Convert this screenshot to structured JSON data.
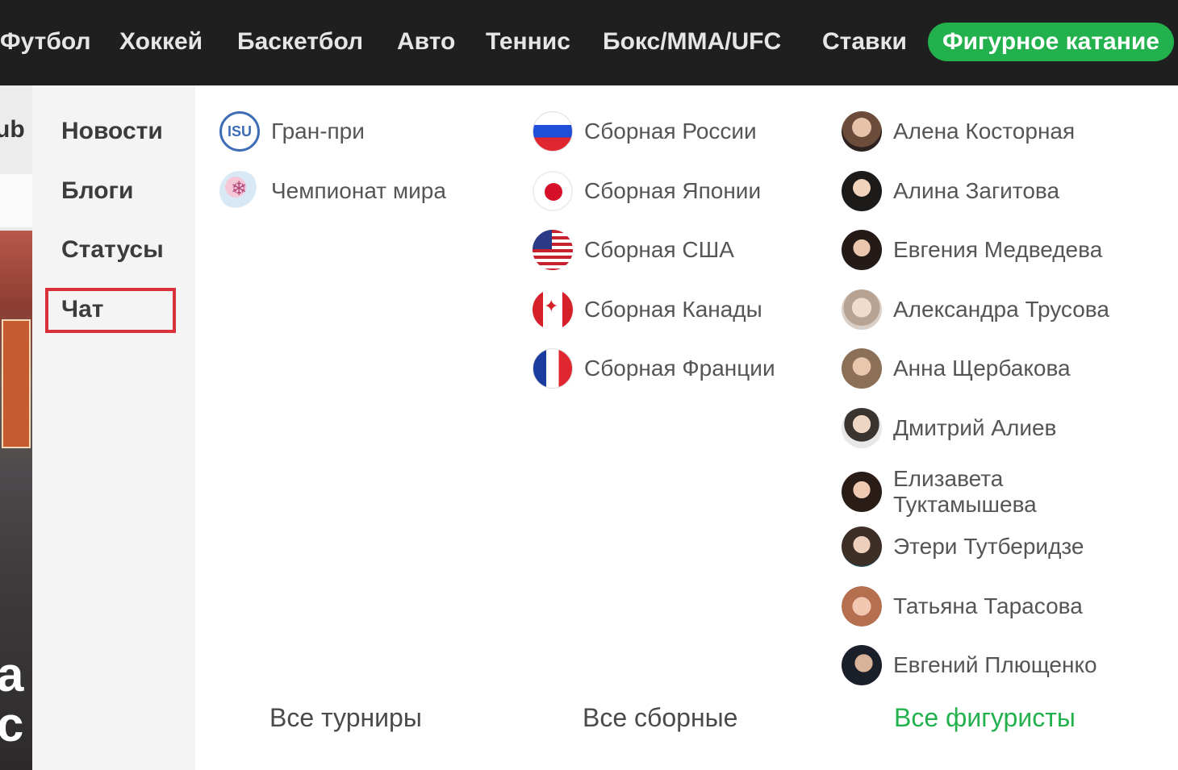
{
  "topnav": {
    "items": [
      "Футбол",
      "Хоккей",
      "Баскетбол",
      "Авто",
      "Теннис",
      "Бокс/ММА/UFC",
      "Ставки",
      "Фигурное катание"
    ],
    "active": "Фигурное катание",
    "active_color": "#22b14c",
    "background": "#1f1f1f"
  },
  "background_page": {
    "fragment_text": "ub",
    "fragment_big": "а\nс"
  },
  "left_menu": {
    "items": [
      "Новости",
      "Блоги",
      "Статусы",
      "Чат"
    ],
    "highlighted": "Чат",
    "highlight_color": "#d9303c"
  },
  "tournaments": {
    "items": [
      {
        "label": "Гран-при",
        "icon": "isu-icon",
        "icon_text": "ISU"
      },
      {
        "label": "Чемпионат мира",
        "icon": "world-championship-icon"
      }
    ],
    "all_label": "Все турниры"
  },
  "teams": {
    "items": [
      {
        "label": "Сборная России",
        "icon": "russia-flag-icon"
      },
      {
        "label": "Сборная Японии",
        "icon": "japan-flag-icon"
      },
      {
        "label": "Сборная США",
        "icon": "usa-flag-icon"
      },
      {
        "label": "Сборная Канады",
        "icon": "canada-flag-icon"
      },
      {
        "label": "Сборная Франции",
        "icon": "france-flag-icon"
      }
    ],
    "all_label": "Все сборные"
  },
  "skaters": {
    "items": [
      {
        "label": "Алена Косторная"
      },
      {
        "label": "Алина Загитова"
      },
      {
        "label": "Евгения Медведева"
      },
      {
        "label": "Александра Трусова"
      },
      {
        "label": "Анна Щербакова"
      },
      {
        "label": "Дмитрий Алиев"
      },
      {
        "label": "Елизавета Туктамышева"
      },
      {
        "label": "Этери Тутберидзе"
      },
      {
        "label": "Татьяна Тарасова"
      },
      {
        "label": "Евгений Плющенко"
      }
    ],
    "all_label": "Все фигуристы",
    "all_color": "#22b14c"
  }
}
